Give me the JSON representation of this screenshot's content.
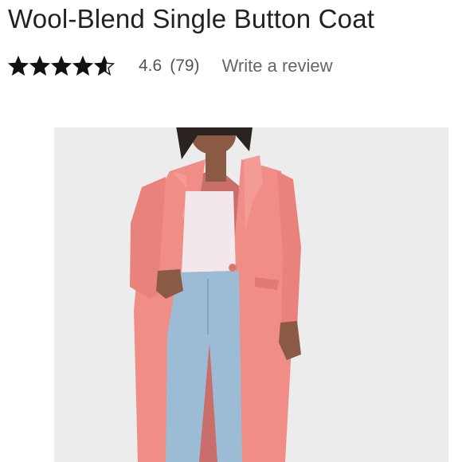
{
  "product": {
    "title": "Wool-Blend Single Button Coat"
  },
  "rating": {
    "score": "4.6",
    "count": "(79)",
    "value": 4.6,
    "max": 5,
    "star_icon": "star-icon",
    "write_review_label": "Write a review"
  },
  "image": {
    "subject": "product-photo",
    "colors": {
      "coat": "#ef8d86",
      "top": "#f2e8ec",
      "jeans": "#9cbcd6",
      "background": "#ececec"
    }
  }
}
